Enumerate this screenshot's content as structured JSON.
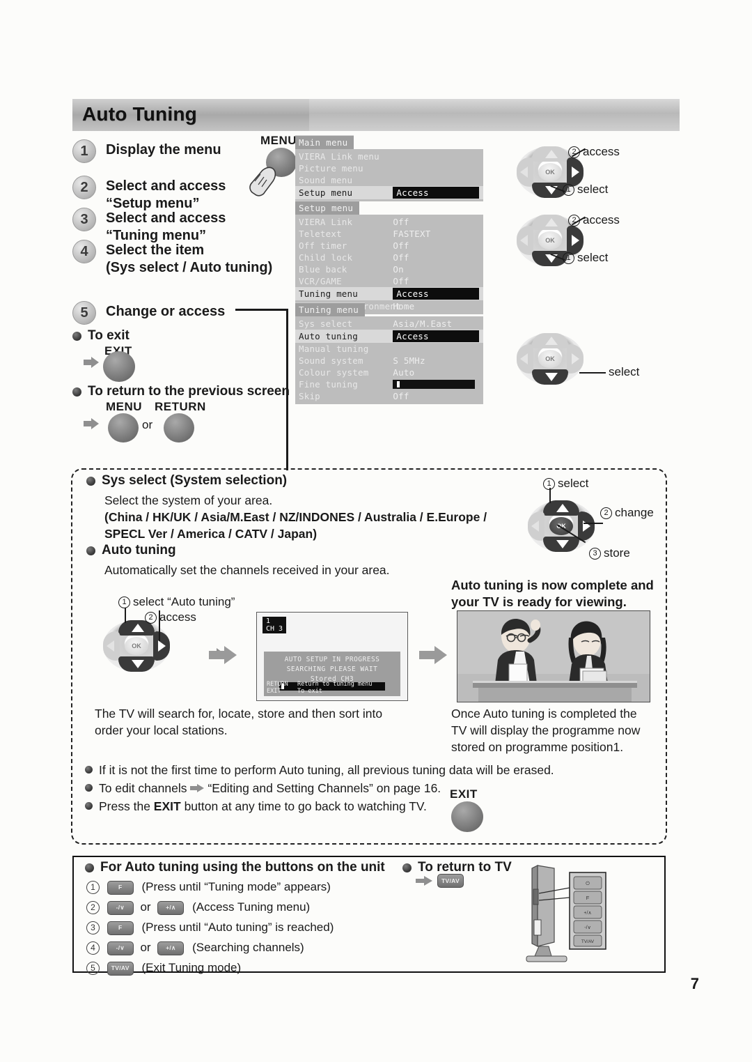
{
  "page": {
    "number": "7",
    "title": "Auto Tuning"
  },
  "steps": [
    {
      "num": "1",
      "text": "Display the menu"
    },
    {
      "num": "2",
      "text": "Select and access\n\"Setup menu\""
    },
    {
      "num": "3",
      "text": "Select and access\n\"Tuning menu\""
    },
    {
      "num": "4",
      "text": "Select the item\n(Sys select / Auto tuning)"
    },
    {
      "num": "5",
      "text": "Change or access"
    }
  ],
  "step_labels": {
    "step1": "Display the menu",
    "step2_l1": "Select and access",
    "step2_l2": "“Setup menu”",
    "step3_l1": "Select and access",
    "step3_l2": "“Tuning menu”",
    "step4_l1": "Select the item",
    "step4_l2": "(Sys select / Auto tuning)",
    "step5": "Change or access"
  },
  "remote": {
    "menu_label": "MENU",
    "exit_label": "EXIT",
    "return_label": "RETURN",
    "or_label": "or",
    "to_exit": "To exit",
    "to_return": "To return to the previous screen"
  },
  "osd": {
    "main_menu": {
      "title": "Main menu",
      "rows": [
        {
          "label": "VIERA Link menu",
          "value": ""
        },
        {
          "label": "Picture menu",
          "value": ""
        },
        {
          "label": "Sound menu",
          "value": ""
        },
        {
          "label": "Setup menu",
          "value": "Access",
          "selected": true,
          "access": true
        }
      ]
    },
    "setup_menu": {
      "title": "Setup menu",
      "rows": [
        {
          "label": "VIERA Link",
          "value": "Off"
        },
        {
          "label": "Teletext",
          "value": "FASTEXT"
        },
        {
          "label": "Off timer",
          "value": "Off"
        },
        {
          "label": "Child lock",
          "value": "Off"
        },
        {
          "label": "Blue back",
          "value": "On"
        },
        {
          "label": "VCR/GAME",
          "value": "Off"
        },
        {
          "label": "Tuning menu",
          "value": "Access",
          "selected": true,
          "access": true
        },
        {
          "label": "Viewing environment",
          "value": "Home"
        }
      ]
    },
    "tuning_menu": {
      "title": "Tuning menu",
      "rows": [
        {
          "label": "Sys select",
          "value": "Asia/M.East"
        },
        {
          "label": "Auto tuning",
          "value": "Access",
          "selected": true,
          "access": true
        },
        {
          "label": "Manual tuning",
          "value": ""
        },
        {
          "label": "Sound system",
          "value": "S 5MHz"
        },
        {
          "label": "Colour system",
          "value": "Auto"
        },
        {
          "label": "Fine tuning",
          "value": "",
          "slider": true
        },
        {
          "label": "Skip",
          "value": "Off"
        }
      ]
    }
  },
  "dpads": {
    "d1": {
      "c1_num": "1",
      "c1_text": "select",
      "c2_num": "2",
      "c2_text": "access"
    },
    "d2": {
      "c1_num": "1",
      "c1_text": "select",
      "c2_num": "2",
      "c2_text": "access"
    },
    "d3": {
      "c1_text": "select"
    },
    "d4": {
      "c1_num": "1",
      "c1_text": "select",
      "c2_num": "2",
      "c2_text": "change",
      "c3_num": "3",
      "c3_text": "store"
    },
    "d5": {
      "c1_num": "1",
      "c1_text": "select “Auto tuning”",
      "c2_num": "2",
      "c2_text": "access"
    },
    "ok_label": "OK"
  },
  "detail": {
    "sys_select_heading": "Sys select (System selection)",
    "sys_select_line1": "Select the system of your area.",
    "sys_select_line2": "(China / HK/UK / Asia/M.East / NZ/INDONES / Australia / E.Europe /",
    "sys_select_line3": "SPECL Ver / America / CATV / Japan)",
    "auto_tuning_heading": "Auto tuning",
    "auto_tuning_line1": "Automatically set the channels received in your area.",
    "complete_heading_l1": "Auto tuning is now complete and",
    "complete_heading_l2": "your TV is ready for viewing.",
    "left_caption_l1": "The TV will search for, locate, store and then sort into",
    "left_caption_l2": "order your local stations.",
    "right_caption_l1": "Once Auto tuning is completed the",
    "right_caption_l2": "TV will display the programme now",
    "right_caption_l3": "stored on programme position1.",
    "notes": [
      "If it is not the first time to perform Auto tuning, all previous tuning data will be erased.",
      "To edit channels ⇨ “Editing and Setting Channels” on page 16.",
      "Press the EXIT button at any time to go back to watching TV."
    ],
    "note3_pre": "Press the ",
    "note3_bold": "EXIT",
    "note3_post": " button at any time to go back to watching TV.",
    "note2_pre": "To edit channels ",
    "note2_post": "“Editing and Setting Channels” on page 16.",
    "exit_label": "EXIT"
  },
  "tv_progress": {
    "ch_num": "1",
    "ch_label": "CH 3",
    "line1": "AUTO SETUP IN PROGRESS",
    "line2": "SEARCHING    PLEASE WAIT",
    "line3": "Stored  CH3",
    "foot1_key": "RETURN",
    "foot1_text": "Return to tuning menu",
    "foot2_key": "EXIT",
    "foot2_text": "To exit"
  },
  "unit_section": {
    "heading": "For Auto tuning using the buttons on the unit",
    "items": [
      {
        "num": "1",
        "btn1": "F",
        "btn2": "",
        "or": "",
        "text": "(Press until “Tuning mode” appears)"
      },
      {
        "num": "2",
        "btn1": "-/∨",
        "btn2": "+/∧",
        "or": "or",
        "text": "(Access Tuning menu)"
      },
      {
        "num": "3",
        "btn1": "F",
        "btn2": "",
        "or": "",
        "text": "(Press until “Auto tuning” is reached)"
      },
      {
        "num": "4",
        "btn1": "-/∨",
        "btn2": "+/∧",
        "or": "or",
        "text": "(Searching channels)"
      },
      {
        "num": "5",
        "btn1": "TV/AV",
        "btn2": "",
        "or": "",
        "text": "(Exit Tuning mode)"
      }
    ],
    "return_heading": "To return to TV",
    "return_btn": "TV/AV",
    "unit_buttons": [
      "⏻",
      "F",
      "+/∧",
      "-/∨",
      "TV/AV"
    ]
  }
}
